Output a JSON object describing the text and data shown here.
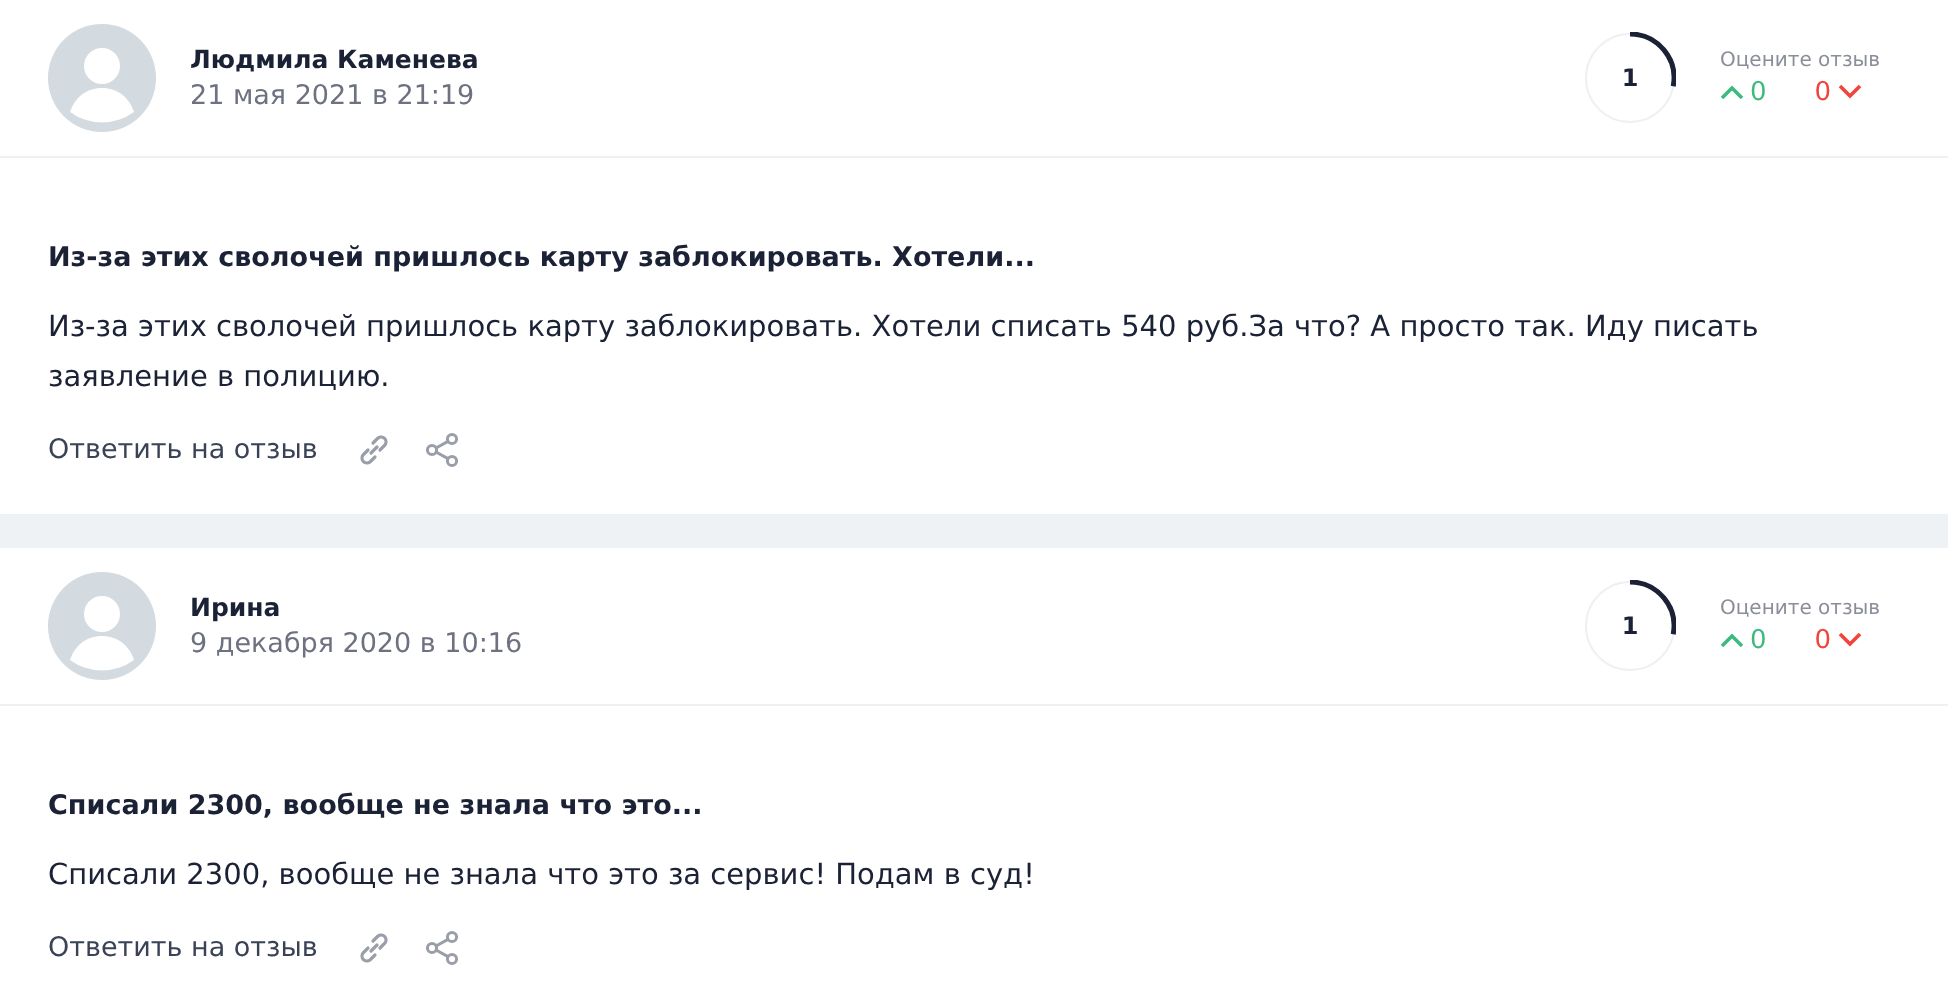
{
  "reviews": [
    {
      "author": "Людмила Каменева",
      "date": "21 мая 2021 в 21:19",
      "rating": "1",
      "rate_label": "Оцените отзыв",
      "likes": "0",
      "dislikes": "0",
      "title": "Из-за этих сволочей пришлось карту заблокировать. Хотели...",
      "text": "Из-за этих сволочей пришлось карту заблокировать. Хотели списать 540 руб.За что? А просто так. Иду писать заявление в полицию.",
      "reply": "Ответить на отзыв"
    },
    {
      "author": "Ирина",
      "date": "9 декабря 2020 в 10:16",
      "rating": "1",
      "rate_label": "Оцените отзыв",
      "likes": "0",
      "dislikes": "0",
      "title": "Списали 2300, вообще не знала что это...",
      "text": "Списали 2300, вообще не знала что это за сервис! Подам в суд!",
      "reply": "Ответить на отзыв"
    }
  ]
}
